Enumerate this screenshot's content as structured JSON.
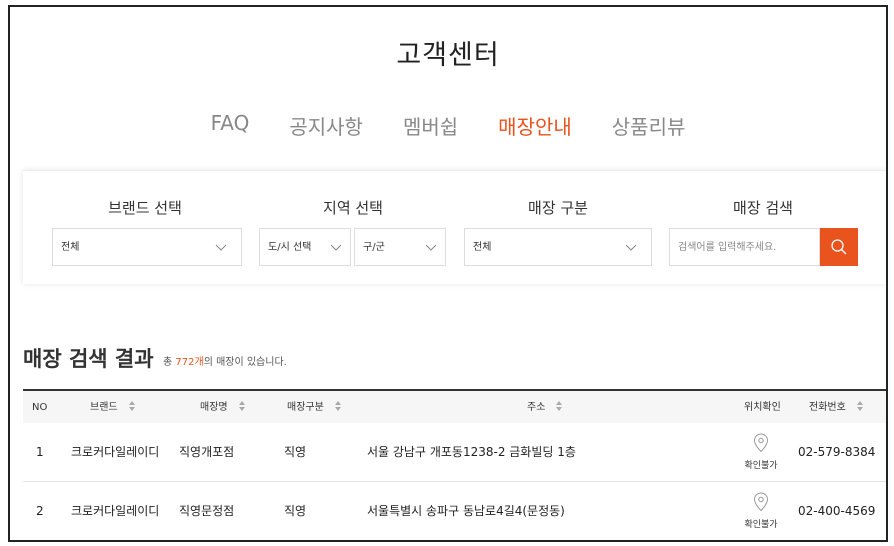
{
  "page_title": "고객센터",
  "tabs": [
    {
      "label": "FAQ",
      "active": false
    },
    {
      "label": "공지사항",
      "active": false
    },
    {
      "label": "멤버쉽",
      "active": false
    },
    {
      "label": "매장안내",
      "active": true
    },
    {
      "label": "상품리뷰",
      "active": false
    }
  ],
  "filters": {
    "brand_label": "브랜드 선택",
    "brand_value": "전체",
    "region_label": "지역 선택",
    "region_city_value": "도/시 선택",
    "region_district_value": "구/군",
    "store_type_label": "매장 구분",
    "store_type_value": "전체",
    "store_search_label": "매장 검색",
    "store_search_placeholder": "검색어를 입력해주세요."
  },
  "results": {
    "title": "매장 검색 결과",
    "count_prefix": "총 ",
    "count_num": "772개",
    "count_suffix": "의 매장이 있습니다."
  },
  "table": {
    "headers": {
      "no": "NO",
      "brand": "브랜드",
      "store_name": "매장명",
      "store_type": "매장구분",
      "address": "주소",
      "location": "위치확인",
      "phone": "전화번호"
    },
    "rows": [
      {
        "no": "1",
        "brand": "크로커다일레이디",
        "store_name": "직영개포점",
        "store_type": "직영",
        "address": "서울 강남구 개포동1238-2 금화빌딩 1층",
        "location": "확인불가",
        "phone": "02-579-8384"
      },
      {
        "no": "2",
        "brand": "크로커다일레이디",
        "store_name": "직영문정점",
        "store_type": "직영",
        "address": "서울특별시 송파구 동남로4길4(문정동)",
        "location": "확인불가",
        "phone": "02-400-4569"
      }
    ]
  },
  "colors": {
    "accent": "#e8531e",
    "text": "#222222",
    "muted": "#888888"
  },
  "icons": {
    "dropdown": "chevron-down-icon",
    "search": "search-icon",
    "sort": "sort-icon",
    "location": "map-pin-icon"
  }
}
